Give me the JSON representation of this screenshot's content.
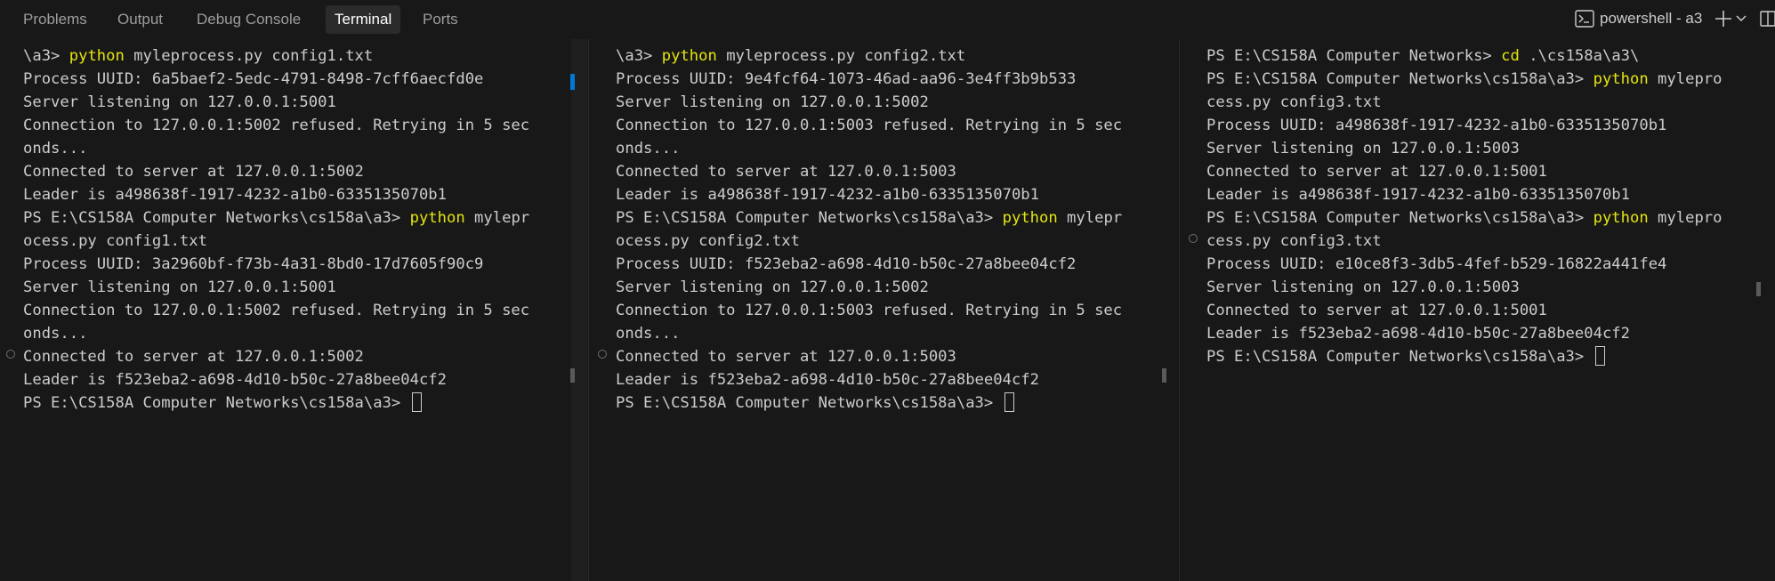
{
  "tabs": [
    {
      "label": "Problems"
    },
    {
      "label": "Output"
    },
    {
      "label": "Debug Console"
    },
    {
      "label": "Terminal"
    },
    {
      "label": "Ports"
    }
  ],
  "terminal_selector": {
    "label": "powershell - a3",
    "icon": "terminal-icon"
  },
  "actions": {
    "new_terminal": "plus-icon",
    "dropdown": "chevron-down-icon",
    "split": "split-terminal-icon"
  },
  "colors": {
    "background": "#181818",
    "text": "#cccccc",
    "command": "#e5e510",
    "active_tab_bg": "#2b2b2b",
    "scroll_marker": "#0078d4"
  },
  "panes": [
    {
      "lines": [
        {
          "plain": "\\a3> ",
          "cmd": "python",
          "rest": " myleprocess.py config1.txt"
        },
        {
          "plain": "Process UUID: 6a5baef2-5edc-4791-8498-7cff6aecfd0e"
        },
        {
          "plain": "Server listening on 127.0.0.1:5001"
        },
        {
          "plain": "Connection to 127.0.0.1:5002 refused. Retrying in 5 sec"
        },
        {
          "plain": "onds..."
        },
        {
          "plain": "Connected to server at 127.0.0.1:5002"
        },
        {
          "plain": "Leader is a498638f-1917-4232-a1b0-6335135070b1"
        },
        {
          "plain": "PS E:\\CS158A Computer Networks\\cs158a\\a3> ",
          "cmd": "python",
          "rest": " mylepr"
        },
        {
          "plain": "ocess.py config1.txt"
        },
        {
          "plain": "Process UUID: 3a2960bf-f73b-4a31-8bd0-17d7605f90c9"
        },
        {
          "plain": "Server listening on 127.0.0.1:5001"
        },
        {
          "plain": "Connection to 127.0.0.1:5002 refused. Retrying in 5 sec"
        },
        {
          "plain": "onds..."
        },
        {
          "plain": "Connected to server at 127.0.0.1:5002"
        },
        {
          "plain": "Leader is f523eba2-a698-4d10-b50c-27a8bee04cf2"
        },
        {
          "plain": "PS E:\\CS158A Computer Networks\\cs158a\\a3> ",
          "cursor": true
        }
      ]
    },
    {
      "lines": [
        {
          "plain": "\\a3> ",
          "cmd": "python",
          "rest": " myleprocess.py config2.txt"
        },
        {
          "plain": "Process UUID: 9e4fcf64-1073-46ad-aa96-3e4ff3b9b533"
        },
        {
          "plain": "Server listening on 127.0.0.1:5002"
        },
        {
          "plain": "Connection to 127.0.0.1:5003 refused. Retrying in 5 sec"
        },
        {
          "plain": "onds..."
        },
        {
          "plain": "Connected to server at 127.0.0.1:5003"
        },
        {
          "plain": "Leader is a498638f-1917-4232-a1b0-6335135070b1"
        },
        {
          "plain": "PS E:\\CS158A Computer Networks\\cs158a\\a3> ",
          "cmd": "python",
          "rest": " mylepr"
        },
        {
          "plain": "ocess.py config2.txt"
        },
        {
          "plain": "Process UUID: f523eba2-a698-4d10-b50c-27a8bee04cf2"
        },
        {
          "plain": "Server listening on 127.0.0.1:5002"
        },
        {
          "plain": "Connection to 127.0.0.1:5003 refused. Retrying in 5 sec"
        },
        {
          "plain": "onds..."
        },
        {
          "plain": "Connected to server at 127.0.0.1:5003"
        },
        {
          "plain": "Leader is f523eba2-a698-4d10-b50c-27a8bee04cf2"
        },
        {
          "plain": "PS E:\\CS158A Computer Networks\\cs158a\\a3> ",
          "cursor": true
        }
      ]
    },
    {
      "lines": [
        {
          "plain": "PS E:\\CS158A Computer Networks> ",
          "cmd": "cd",
          "rest": " .\\cs158a\\a3\\"
        },
        {
          "plain": "PS E:\\CS158A Computer Networks\\cs158a\\a3> ",
          "cmd": "python",
          "rest": " mylepro"
        },
        {
          "plain": "cess.py config3.txt"
        },
        {
          "plain": "Process UUID: a498638f-1917-4232-a1b0-6335135070b1"
        },
        {
          "plain": "Server listening on 127.0.0.1:5003"
        },
        {
          "plain": "Connected to server at 127.0.0.1:5001"
        },
        {
          "plain": "Leader is a498638f-1917-4232-a1b0-6335135070b1"
        },
        {
          "plain": "PS E:\\CS158A Computer Networks\\cs158a\\a3> ",
          "cmd": "python",
          "rest": " mylepro"
        },
        {
          "plain": "cess.py config3.txt"
        },
        {
          "plain": "Process UUID: e10ce8f3-3db5-4fef-b529-16822a441fe4"
        },
        {
          "plain": "Server listening on 127.0.0.1:5003"
        },
        {
          "plain": "Connected to server at 127.0.0.1:5001"
        },
        {
          "plain": "Leader is f523eba2-a698-4d10-b50c-27a8bee04cf2"
        },
        {
          "plain": "PS E:\\CS158A Computer Networks\\cs158a\\a3> ",
          "cursor": true
        }
      ]
    }
  ]
}
